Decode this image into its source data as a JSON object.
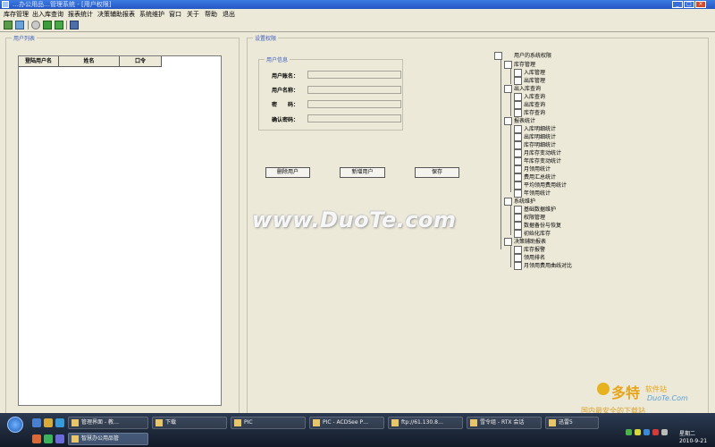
{
  "window": {
    "title": "…办公用品…管理系统 - [用户权限]",
    "controls": [
      "_",
      "□",
      "×"
    ]
  },
  "menu": [
    "库存管理",
    "出入库查询",
    "报表统计",
    "决策辅助报表",
    "系统维护",
    "窗口",
    "关于",
    "帮助",
    "退出"
  ],
  "user_list": {
    "legend": "用户列表",
    "columns": [
      "登陆用户名",
      "姓名",
      "口令"
    ]
  },
  "perm_panel": {
    "legend": "设置权限",
    "info_legend": "用户信息",
    "fields": [
      {
        "label": "用户账名：",
        "value": ""
      },
      {
        "label": "用户名称：",
        "value": ""
      },
      {
        "label": "密　　码：",
        "value": ""
      },
      {
        "label": "确认密码：",
        "value": ""
      }
    ],
    "buttons": {
      "delete": "删除用户",
      "add": "新增用户",
      "save": "保存"
    }
  },
  "tree": {
    "root": "用户的系统权限",
    "groups": [
      {
        "label": "库存管理",
        "items": [
          "入库管理",
          "出库管理"
        ]
      },
      {
        "label": "出入库查询",
        "items": [
          "入库查询",
          "出库查询",
          "库存查询"
        ]
      },
      {
        "label": "报表统计",
        "items": [
          "入库明细统计",
          "出库明细统计",
          "库存明细统计",
          "月库存变动统计",
          "年库存变动统计",
          "月领用统计",
          "费用汇总统计",
          "平均领用费用统计",
          "年领用统计"
        ]
      },
      {
        "label": "系统维护",
        "items": [
          "基础数据维护",
          "权限管理",
          "数据备份与恢复",
          "初始化库存"
        ]
      },
      {
        "label": "决策辅助报表",
        "items": [
          "库存报警",
          "领用排名",
          "月领用费用曲线对比"
        ]
      }
    ]
  },
  "watermark": "www.DuoTe.com",
  "corner_logo": {
    "brand": "多特",
    "sub": "软件站",
    "site": "DuoTe.Com",
    "slogan": "国内最安全的下载站"
  },
  "taskbar": {
    "tasks_row1": [
      "管理界面 - 教…",
      "下载",
      "PIC",
      "PIC - ACDSee P…",
      "ftp://61.130.8…",
      "雪令组 - RTX 会话",
      "迅雷5"
    ],
    "tasks_row2": [
      "智慧办公用品管"
    ],
    "clock": {
      "time": "星期二",
      "date": "2010-9-21"
    }
  },
  "colors": {
    "title_bar": "#2556c4",
    "legend": "#3c5cbf",
    "window_bg": "#ece9d8"
  }
}
